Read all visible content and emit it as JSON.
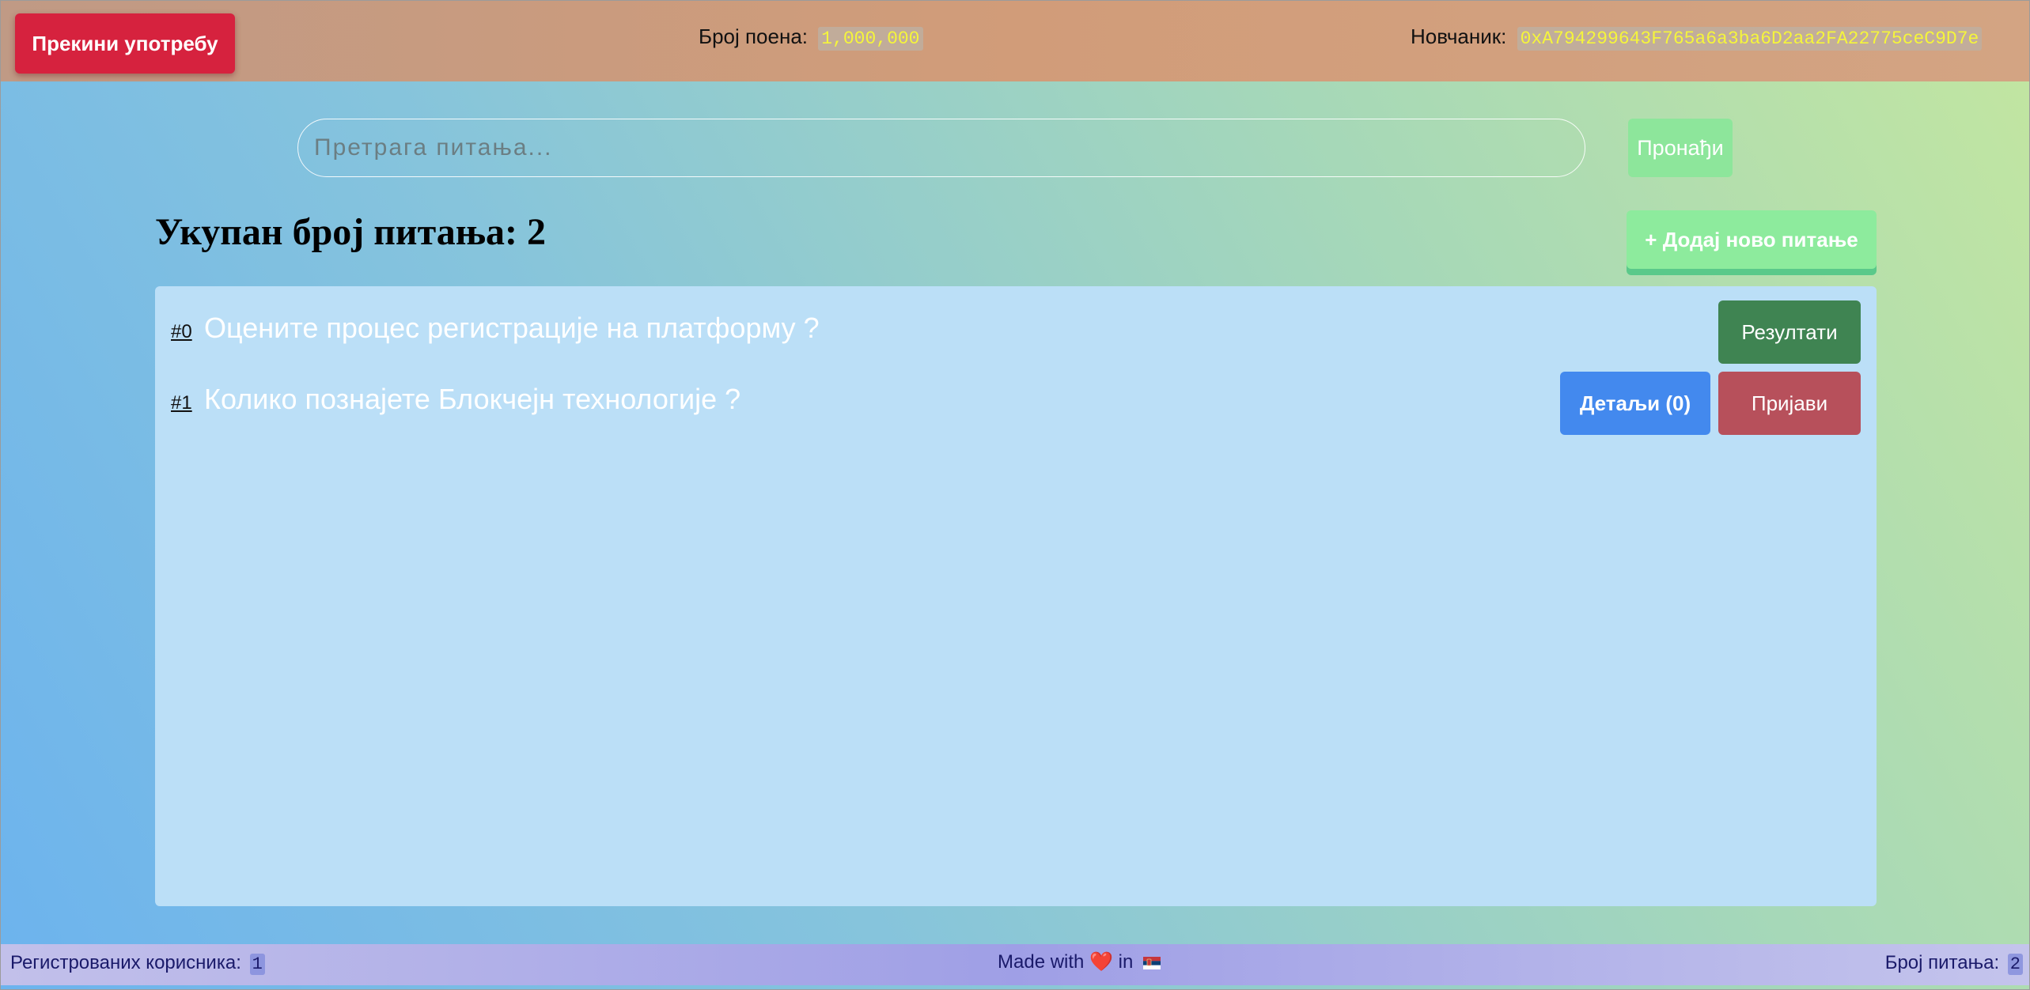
{
  "header": {
    "quit_button": "Прекини употребу",
    "points_label": "Број поена:",
    "points_value": "1,000,000",
    "wallet_label": "Новчаник:",
    "wallet_value": "0xA794299643F765a6a3ba6D2aa2FA22775ceC9D7e"
  },
  "search": {
    "placeholder": "Претрага питања...",
    "button": "Пронађи"
  },
  "main": {
    "title": "Укупан број питања: 2",
    "add_button": "+ Додај ново питање",
    "questions": [
      {
        "index": "#0",
        "text": "Оцените процес регистрације на платформу ?",
        "results_button": "Резултати"
      },
      {
        "index": "#1",
        "text": "Колико познајете Блокчејн технологије ?",
        "details_button": "Детаљи (0)",
        "report_button": "Пријави"
      }
    ]
  },
  "footer": {
    "users_label": "Регистрованих корисника:",
    "users_count": "1",
    "made_with_prefix": "Made with",
    "heart_icon": "❤️",
    "made_with_mid": "in",
    "flag_icon": "serbia-flag",
    "questions_label": "Број питања:",
    "questions_count": "2"
  },
  "colors": {
    "quit_button": "#d6223e",
    "find_button": "#8de69b",
    "add_button": "#8deb9d",
    "results_button": "#3f8452",
    "details_button": "#4389ee",
    "report_button": "#b7505b",
    "panel": "#bbdff7",
    "wallet_text": "#f5f53b"
  }
}
